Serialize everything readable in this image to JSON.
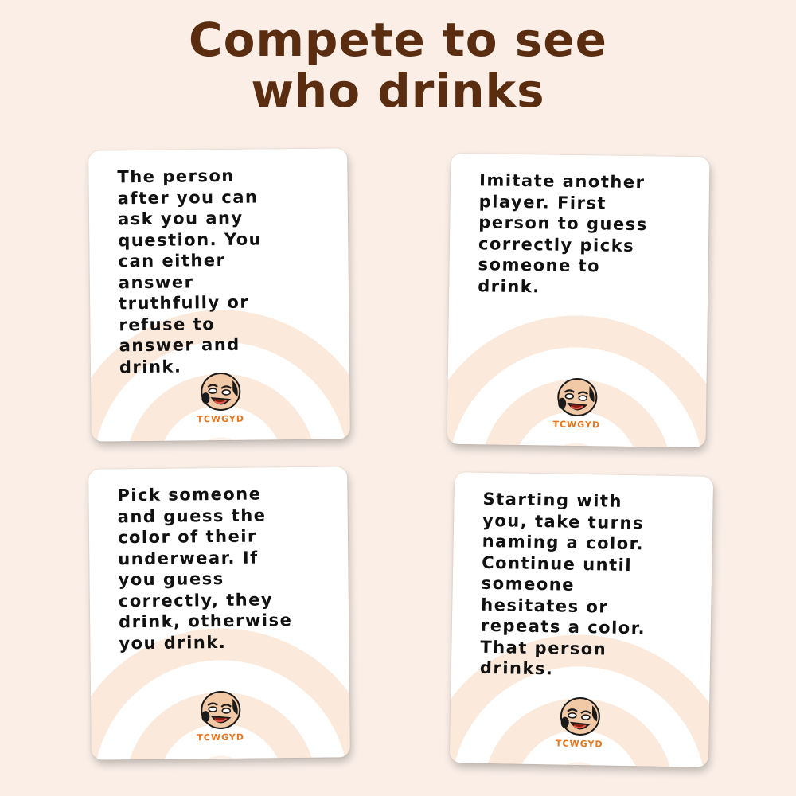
{
  "headline": {
    "line1": "Compete to see",
    "line2": "who drinks"
  },
  "cards": [
    {
      "lines": [
        "The person",
        "after you can",
        "ask you any",
        "question. You",
        "can either",
        "answer",
        "truthfully or",
        "refuse to",
        "answer and",
        "drink."
      ],
      "brand": "TCWGYD"
    },
    {
      "lines": [
        "Imitate another",
        "player. First",
        "person to guess",
        "correctly picks",
        "someone to",
        "drink."
      ],
      "brand": "TCWGYD"
    },
    {
      "lines": [
        "Pick someone",
        "and guess the",
        "color of their",
        "underwear. If",
        "you guess",
        "correctly, they",
        "drink, otherwise",
        "you drink."
      ],
      "brand": "TCWGYD"
    },
    {
      "lines": [
        "Starting with",
        "you, take turns",
        "naming a color.",
        "Continue until",
        "someone",
        "hesitates or",
        "repeats a color.",
        "That person",
        "drinks."
      ],
      "brand": "TCWGYD"
    }
  ],
  "colors": {
    "background": "#faeee7",
    "headline": "#5a2d10",
    "brand": "#e8771f"
  },
  "icons": {
    "logo": "laughing-bald-face-icon"
  }
}
